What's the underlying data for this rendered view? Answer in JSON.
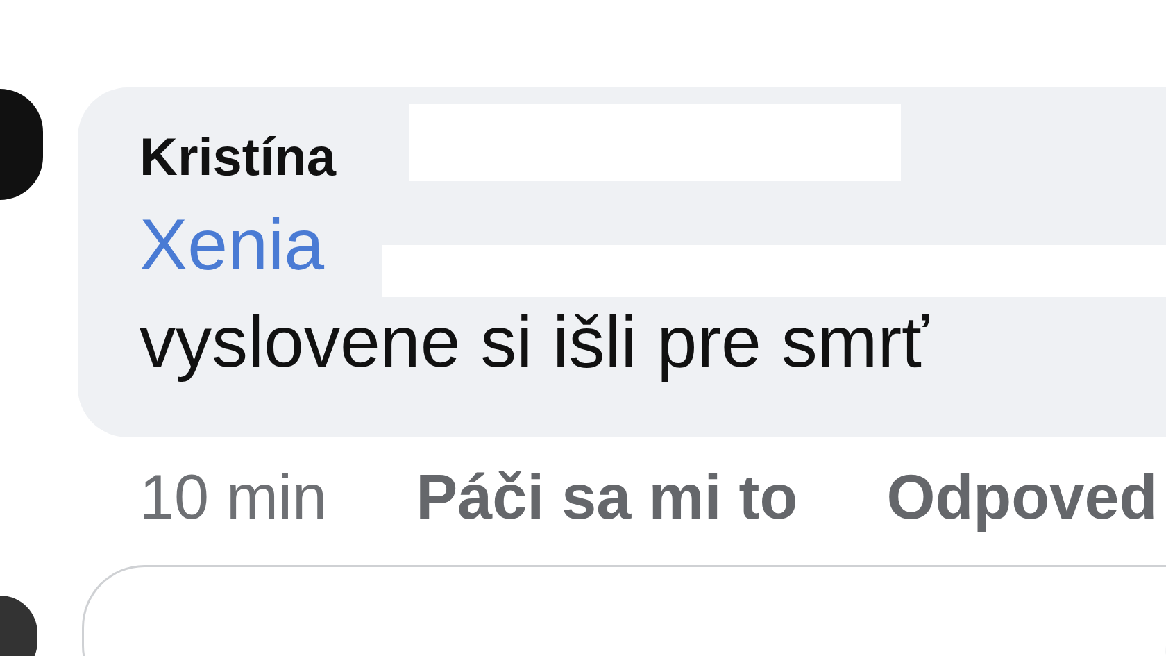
{
  "comment": {
    "author": "Kristína",
    "mention": "Xenia",
    "text": "vyslovene si išli pre smrť",
    "time": "10 min",
    "actions": [
      {
        "label": "Páči sa mi to"
      },
      {
        "label": "Odpoved"
      }
    ]
  }
}
